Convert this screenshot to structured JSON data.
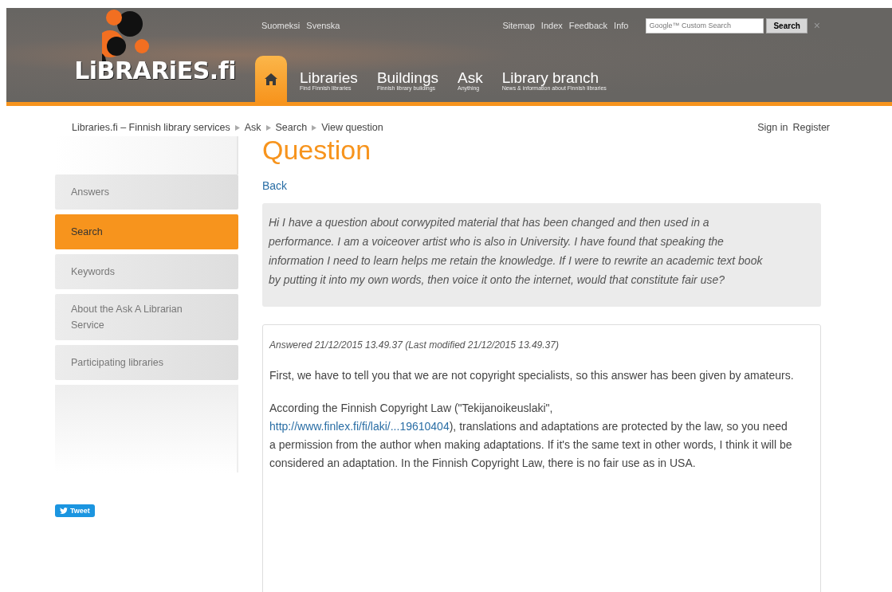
{
  "header": {
    "logo": "LiBRARiES.fi",
    "languages": [
      "Suomeksi",
      "Svenska"
    ],
    "utility_links": [
      "Sitemap",
      "Index",
      "Feedback",
      "Info"
    ],
    "search": {
      "placeholder": "Google™ Custom Search",
      "button": "Search",
      "close": "×"
    },
    "nav": [
      {
        "kind": "home",
        "selected": true
      },
      {
        "kind": "link",
        "title": "Libraries",
        "subtitle": "Find Finnish libraries",
        "selected": false
      },
      {
        "kind": "link",
        "title": "Buildings",
        "subtitle": "Finnish library buildings",
        "selected": false
      },
      {
        "kind": "link",
        "title": "Ask",
        "subtitle": "Anything",
        "selected": false
      },
      {
        "kind": "link",
        "title": "Library branch",
        "subtitle": "News & information about Finnish libraries",
        "selected": false
      }
    ]
  },
  "breadcrumb": [
    "Libraries.fi – Finnish library services",
    "Ask",
    "Search",
    "View question"
  ],
  "account_links": [
    "Sign in",
    "Register"
  ],
  "sidebar": {
    "items": [
      {
        "label": "Answers",
        "selected": false
      },
      {
        "label": "Search",
        "selected": true
      },
      {
        "label": "Keywords",
        "selected": false
      },
      {
        "label": "About the Ask A Librarian Service",
        "selected": false
      },
      {
        "label": "Participating libraries",
        "selected": false
      }
    ],
    "tweet": "Tweet"
  },
  "page_title": "Question",
  "back_link": "Back",
  "question": "Hi I have a question about corwypited material that has been changed and then used in a performance. I am a voiceover artist who is also in University. I have found that speaking the information I need to learn helps me retain the knowledge. If I were to rewrite an academic text book by putting it into my own words, then voice it onto the internet, would that constitute fair use?",
  "answer": {
    "meta": "Answered 21/12/2015 13.49.37 (Last modified 21/12/2015 13.49.37)",
    "paragraphs": [
      {
        "text": "First, we have to tell you that we are not copyright specialists, so this answer has been given by amateurs."
      },
      {
        "text": "According the Finnish Copyright Law (\"Tekijanoikeuslaki\",",
        "link": "http://www.finlex.fi/fi/laki/...19610404",
        "after": "), translations and adaptations are protected by the law, so you need a permission from the author when making adaptations. If it's the same text in other words, I think it will be considered an adaptation. In the Finnish Copyright Law, there is no fair use as in USA."
      }
    ]
  }
}
